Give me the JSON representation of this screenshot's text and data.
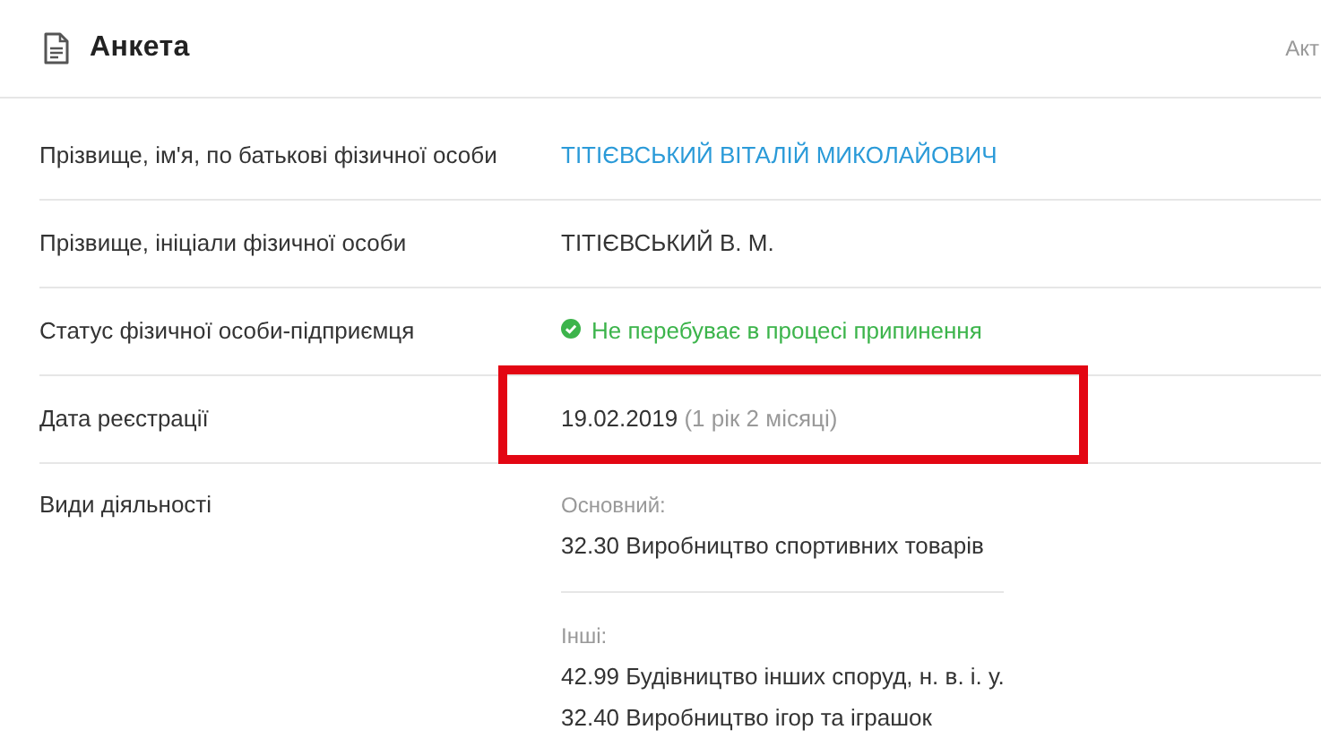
{
  "header": {
    "title": "Анкета",
    "right_text": "Акт"
  },
  "rows": [
    {
      "kind": "link",
      "label": "Прізвище, ім'я, по батькові фізичної особи",
      "value": "ТІТІЄВСЬКИЙ ВІТАЛІЙ МИКОЛАЙОВИЧ"
    },
    {
      "kind": "text",
      "label": "Прізвище, ініціали фізичної особи",
      "value": "ТІТІЄВСЬКИЙ В. М."
    },
    {
      "kind": "status",
      "label": "Статус фізичної особи-підприємця",
      "value": "Не перебуває в процесі припинення"
    },
    {
      "kind": "date",
      "label": "Дата реєстрації",
      "value": "19.02.2019",
      "note": "(1 рік 2 місяці)",
      "highlighted": true
    },
    {
      "kind": "groups",
      "label": "Види діяльності",
      "groups": [
        {
          "title": "Основний:",
          "items": [
            "32.30 Виробництво спортивних товарів"
          ]
        },
        {
          "title": "Інші:",
          "items": [
            "42.99 Будівництво інших споруд, н. в. і. у.",
            "32.40 Виробництво ігор та іграшок"
          ]
        }
      ]
    }
  ]
}
